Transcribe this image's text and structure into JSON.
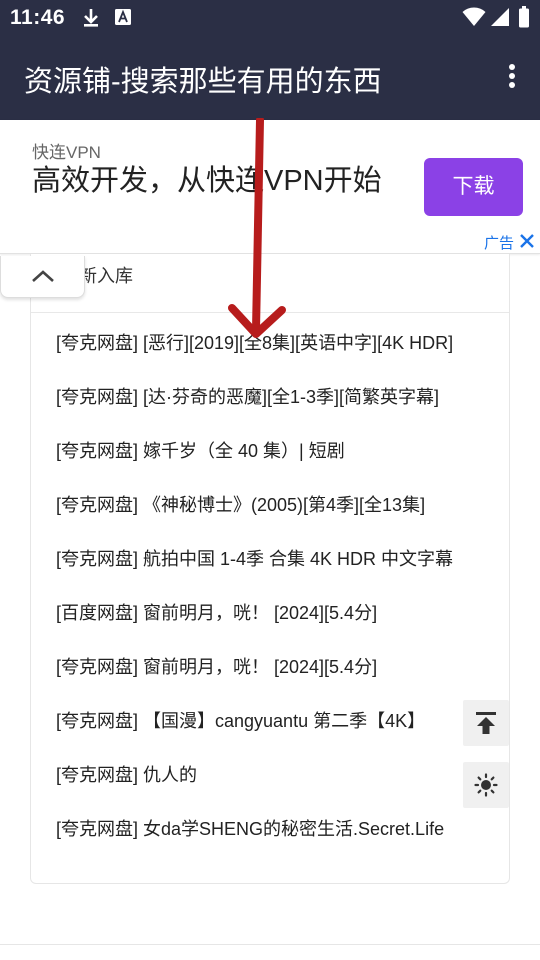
{
  "status_bar": {
    "time": "11:46",
    "icons": [
      "download-icon",
      "font-a-icon",
      "wifi-icon",
      "signal-icon",
      "battery-icon"
    ]
  },
  "app_bar": {
    "title": "资源铺-搜索那些有用的东西",
    "menu_icon": "more-vert-icon",
    "background": "#2b2f45"
  },
  "ad": {
    "brand": "快连VPN",
    "headline": "高效开发，从快连VPN开始",
    "cta": "下载",
    "cta_color": "#8b41e6",
    "tag": "广告"
  },
  "section": {
    "title": "新入库"
  },
  "list": {
    "items": [
      "[夸克网盘] [恶行][2019][全8集][英语中字][4K HDR]",
      "[夸克网盘] [达·芬奇的恶魔][全1-3季][简繁英字幕]",
      "[夸克网盘] 嫁千岁（全 40 集）| 短剧",
      "[夸克网盘] 《神秘博士》(2005)[第4季][全13集]",
      "[夸克网盘] 航拍中国 1-4季 合集 4K HDR 中文字幕",
      "[百度网盘] 窗前明月，咣！ [2024][5.4分]",
      "[夸克网盘] 窗前明月，咣！ [2024][5.4分]",
      "[夸克网盘] 【国漫】cangyuantu 第二季【4K】",
      "[夸克网盘] 仇人的",
      "[夸克网盘] 女da学SHENG的秘密生活.Secret.Life"
    ]
  },
  "floating_buttons": {
    "top_icon": "back-to-top-icon",
    "theme_icon": "brightness-icon"
  },
  "annotation_color": "#b71c1c"
}
